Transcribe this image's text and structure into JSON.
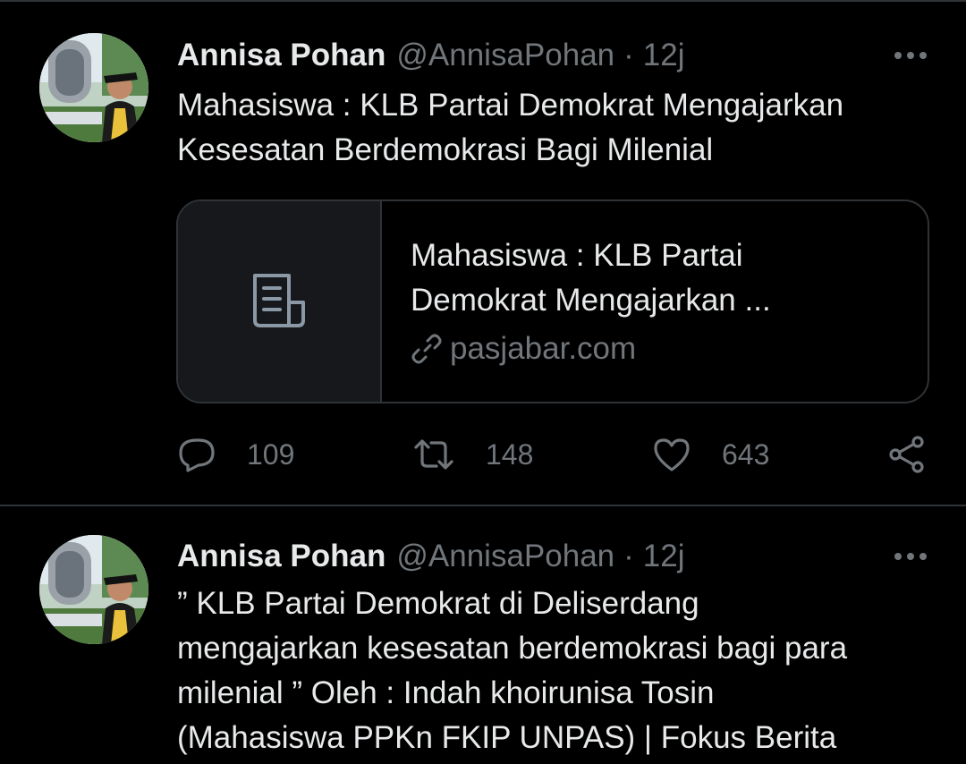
{
  "tweets": [
    {
      "author_name": "Annisa Pohan",
      "handle": "@AnnisaPohan",
      "separator": "·",
      "time": "12j",
      "text": "Mahasiswa : KLB Partai Demokrat Mengajarkan\nKesesatan Berdemokrasi Bagi Milenial",
      "card": {
        "title": "Mahasiswa : KLB Partai\nDemokrat Mengajarkan ...",
        "domain": "pasjabar.com",
        "thumb_icon": "article-icon",
        "link_icon": "link-icon"
      },
      "stats": {
        "replies": "109",
        "retweets": "148",
        "likes": "643"
      }
    },
    {
      "author_name": "Annisa Pohan",
      "handle": "@AnnisaPohan",
      "separator": "·",
      "time": "12j",
      "text": "” KLB Partai Demokrat di Deliserdang\nmengajarkan kesesatan berdemokrasi bagi para\nmilenial ” Oleh : Indah khoirunisa Tosin\n(Mahasiswa PPKn FKIP UNPAS) | Fokus Berita"
    }
  ],
  "icons": {
    "more": "more-icon",
    "reply": "reply-icon",
    "retweet": "retweet-icon",
    "like": "heart-icon",
    "share": "share-icon"
  },
  "colors": {
    "background": "#000000",
    "text": "#e7e9ea",
    "muted": "#71767b",
    "border": "#2f3336",
    "card_thumb": "#16181c"
  }
}
